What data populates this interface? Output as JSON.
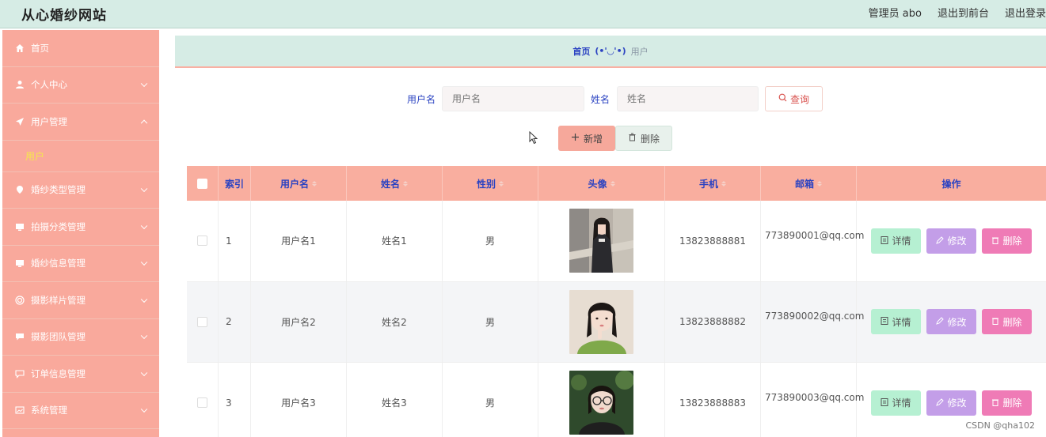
{
  "header": {
    "brand": "从心婚纱网站",
    "admin_label": "管理员 abo",
    "exit_front": "退出到前台",
    "logout": "退出登录"
  },
  "sidebar": {
    "items": [
      {
        "label": "首页",
        "icon": "home-icon"
      },
      {
        "label": "个人中心",
        "icon": "person-icon"
      },
      {
        "label": "用户管理",
        "icon": "send-icon"
      },
      {
        "label": "婚纱类型管理",
        "icon": "location-icon"
      },
      {
        "label": "拍摄分类管理",
        "icon": "monitor-icon"
      },
      {
        "label": "婚纱信息管理",
        "icon": "monitor-icon"
      },
      {
        "label": "摄影样片管理",
        "icon": "target-icon"
      },
      {
        "label": "摄影团队管理",
        "icon": "chat-icon"
      },
      {
        "label": "订单信息管理",
        "icon": "message-icon"
      },
      {
        "label": "系统管理",
        "icon": "picture-icon"
      }
    ],
    "submenu_user": "用户"
  },
  "breadcrumb": {
    "home": "首页",
    "separator": "(•'◡'•)",
    "current": "用户"
  },
  "search": {
    "username_label": "用户名",
    "username_placeholder": "用户名",
    "name_label": "姓名",
    "name_placeholder": "姓名",
    "query_button": "查询"
  },
  "actions": {
    "add_button": "新增",
    "delete_button": "删除"
  },
  "table": {
    "headers": {
      "index": "索引",
      "username": "用户名",
      "name": "姓名",
      "gender": "性别",
      "avatar": "头像",
      "phone": "手机",
      "email": "邮箱",
      "ops": "操作"
    },
    "rows": [
      {
        "index": "1",
        "username": "用户名1",
        "name": "姓名1",
        "gender": "男",
        "phone": "13823888881",
        "email": "773890001@qq.com"
      },
      {
        "index": "2",
        "username": "用户名2",
        "name": "姓名2",
        "gender": "男",
        "phone": "13823888882",
        "email": "773890002@qq.com"
      },
      {
        "index": "3",
        "username": "用户名3",
        "name": "姓名3",
        "gender": "男",
        "phone": "13823888883",
        "email": "773890003@qq.com"
      }
    ],
    "op_labels": {
      "detail": "详情",
      "edit": "修改",
      "delete": "删除"
    }
  },
  "watermark": "CSDN @qha102",
  "colors": {
    "sidebar_bg": "#f9a99c",
    "header_bg": "#d6ece5",
    "accent_blue": "#2b43c2",
    "submenu_yellow": "#f6e74b",
    "detail_btn": "#b6f0d2",
    "edit_btn": "#c39ee8",
    "delete_btn": "#ef7bb6"
  }
}
